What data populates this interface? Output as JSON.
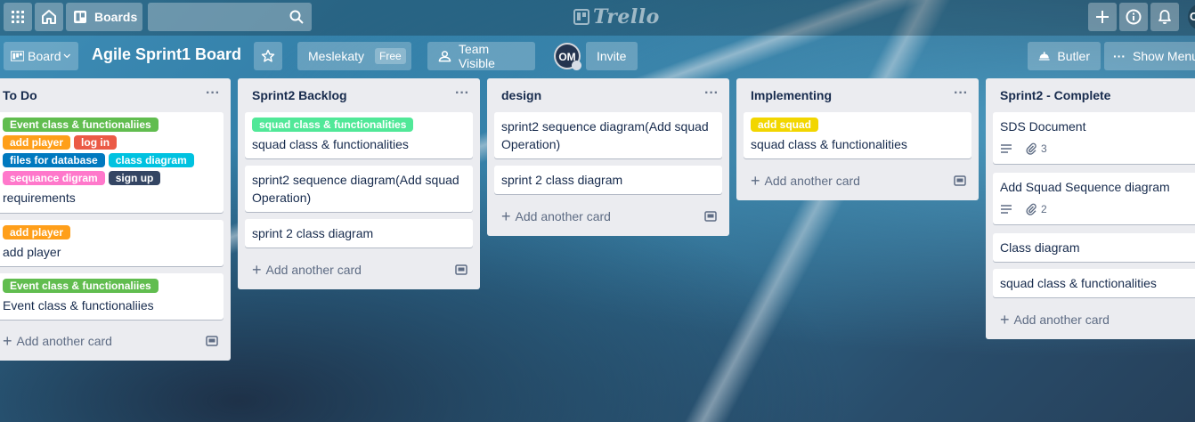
{
  "header": {
    "boards_label": "Boards",
    "logo_text": "Trello",
    "account_initial": "O"
  },
  "board_header": {
    "board_menu_label": "Board",
    "title": "Agile Sprint1 Board",
    "team_label": "Meslekaty",
    "team_badge": "Free",
    "visibility_label": "Team Visible",
    "member_initials": "OM",
    "invite_label": "Invite",
    "butler_label": "Butler",
    "show_menu_label": "Show Menu"
  },
  "colors": {
    "label_green": "#61bd4f",
    "label_orange": "#ff9f1a",
    "label_red": "#eb5a46",
    "label_blue": "#0079bf",
    "label_sky": "#00c2e0",
    "label_pink": "#ff78cb",
    "label_black": "#344563",
    "label_lime": "#51e898",
    "label_yellow": "#f2d600"
  },
  "add_card_label": "Add another card",
  "lists": [
    {
      "title": "To Do",
      "cards": [
        {
          "labels": [
            {
              "text": "Event class & functionaliies",
              "color": "#61bd4f"
            },
            {
              "text": "add player",
              "color": "#ff9f1a"
            },
            {
              "text": "log in",
              "color": "#eb5a46"
            },
            {
              "text": "files for database",
              "color": "#0079bf"
            },
            {
              "text": "class diagram",
              "color": "#00c2e0"
            },
            {
              "text": "sequance digram",
              "color": "#ff78cb"
            },
            {
              "text": "sign up",
              "color": "#344563"
            }
          ],
          "title": "requirements"
        },
        {
          "labels": [
            {
              "text": "add player",
              "color": "#ff9f1a"
            }
          ],
          "title": "add player"
        },
        {
          "labels": [
            {
              "text": "Event class & functionaliies",
              "color": "#61bd4f"
            }
          ],
          "title": "Event class & functionaliies"
        }
      ]
    },
    {
      "title": "Sprint2 Backlog",
      "cards": [
        {
          "labels": [
            {
              "text": "squad class & functionalities",
              "color": "#51e898"
            }
          ],
          "title": "squad class & functionalities"
        },
        {
          "labels": [],
          "title": "sprint2 sequence diagram(Add squad Operation)"
        },
        {
          "labels": [],
          "title": "sprint 2 class diagram"
        }
      ]
    },
    {
      "title": "design",
      "cards": [
        {
          "labels": [],
          "title": "sprint2 sequence diagram(Add squad Operation)"
        },
        {
          "labels": [],
          "title": "sprint 2 class diagram"
        }
      ]
    },
    {
      "title": "Implementing",
      "cards": [
        {
          "labels": [
            {
              "text": "add squad",
              "color": "#f2d600"
            }
          ],
          "title": "squad class & functionalities"
        }
      ]
    },
    {
      "title": "Sprint2 - Complete",
      "cards": [
        {
          "labels": [],
          "title": "SDS Document",
          "attachments": "3"
        },
        {
          "labels": [],
          "title": "Add Squad Sequence diagram",
          "attachments": "2"
        },
        {
          "labels": [],
          "title": "Class diagram"
        },
        {
          "labels": [],
          "title": "squad class & functionalities"
        }
      ]
    }
  ]
}
